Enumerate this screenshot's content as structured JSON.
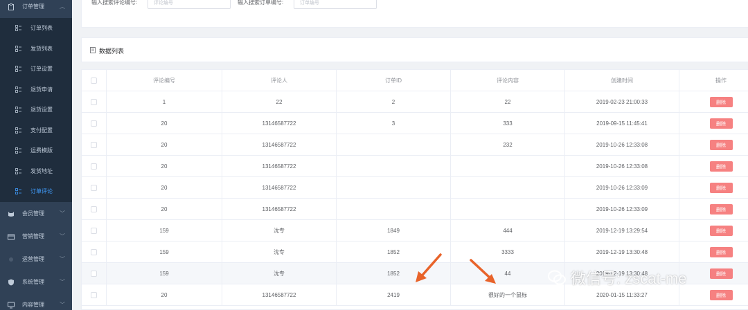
{
  "sidebar": {
    "groups": [
      {
        "label": "订单管理",
        "icon": "clipboard-icon",
        "expanded": true
      },
      {
        "label": "会员管理",
        "icon": "cat-icon"
      },
      {
        "label": "营销管理",
        "icon": "wallet-icon"
      },
      {
        "label": "运营管理",
        "icon": "sun-icon"
      },
      {
        "label": "系统管理",
        "icon": "shield-icon"
      },
      {
        "label": "内容管理",
        "icon": "monitor-icon"
      }
    ],
    "order_items": [
      {
        "label": "订单列表"
      },
      {
        "label": "发货列表"
      },
      {
        "label": "订单设置"
      },
      {
        "label": "退货申请"
      },
      {
        "label": "退货设置"
      },
      {
        "label": "支付配置"
      },
      {
        "label": "运费模版"
      },
      {
        "label": "发货地址"
      },
      {
        "label": "订单评论",
        "active": true
      }
    ]
  },
  "search": {
    "comment_label": "输入搜索评论编号:",
    "comment_placeholder": "评论编号",
    "order_label": "输入搜索订单编号:",
    "order_placeholder": "订单编号"
  },
  "list": {
    "title": "数据列表"
  },
  "table": {
    "headers": [
      "评论编号",
      "评论人",
      "订单ID",
      "评论内容",
      "创建时间",
      "操作"
    ],
    "delete_label": "删除",
    "rows": [
      {
        "id": "1",
        "user": "22",
        "order_id": "2",
        "content": "22",
        "created": "2019-02-23 21:00:33"
      },
      {
        "id": "20",
        "user": "13146587722",
        "order_id": "3",
        "content": "333",
        "created": "2019-09-15 11:45:41"
      },
      {
        "id": "20",
        "user": "13146587722",
        "order_id": "",
        "content": "232",
        "created": "2019-10-26 12:33:08"
      },
      {
        "id": "20",
        "user": "13146587722",
        "order_id": "",
        "content": "",
        "created": "2019-10-26 12:33:08"
      },
      {
        "id": "20",
        "user": "13146587722",
        "order_id": "",
        "content": "",
        "created": "2019-10-26 12:33:09"
      },
      {
        "id": "20",
        "user": "13146587722",
        "order_id": "",
        "content": "",
        "created": "2019-10-26 12:33:09"
      },
      {
        "id": "159",
        "user": "沈专",
        "order_id": "1849",
        "content": "444",
        "created": "2019-12-19 13:29:54"
      },
      {
        "id": "159",
        "user": "沈专",
        "order_id": "1852",
        "content": "3333",
        "created": "2019-12-19 13:30:48"
      },
      {
        "id": "159",
        "user": "沈专",
        "order_id": "1852",
        "content": "44",
        "created": "2019-12-19 13:30:48",
        "hover": true
      },
      {
        "id": "20",
        "user": "13146587722",
        "order_id": "2419",
        "content": "很好的一个鼠标",
        "created": "2020-01-15 11:33:27"
      }
    ]
  },
  "watermark": {
    "text": "微信号: zscat-me"
  },
  "colors": {
    "sidebar_bg": "#304156",
    "submenu_bg": "#1f2d3d",
    "active": "#409eff",
    "danger": "#f56c6c",
    "arrow": "#e8632a"
  }
}
